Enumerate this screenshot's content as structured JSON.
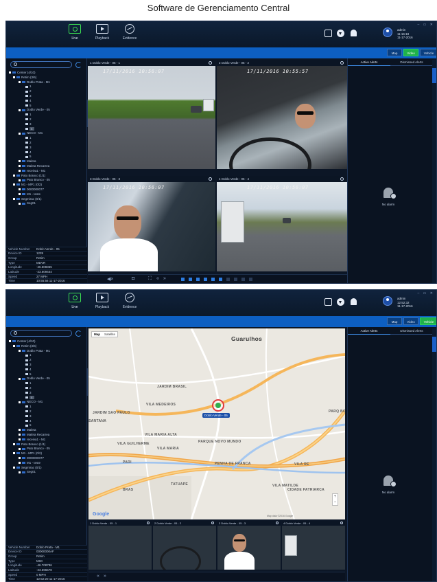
{
  "caption": "Software de Gerenciamento Central",
  "header": {
    "nav": [
      {
        "label": "Live",
        "icon": "monitor-icon",
        "active": true
      },
      {
        "label": "Playback",
        "icon": "playback-icon",
        "active": false
      },
      {
        "label": "Evidence",
        "icon": "evidence-icon",
        "active": false
      }
    ],
    "user": {
      "name": "admin"
    }
  },
  "view_toggle": [
    "Map",
    "Video",
    "Vehicle"
  ],
  "alerts": {
    "tabs": [
      "Active Alerts",
      "Dismissed Alerts"
    ],
    "empty_text": "No alarm"
  },
  "info_labels": [
    "Vehicle Number",
    "Device ID",
    "Group",
    "Type",
    "Longitude",
    "Latitude",
    "Speed",
    "Time"
  ],
  "shot1": {
    "user_time": "11:16:18",
    "user_date": "11-17-2016",
    "tree": [
      {
        "label": "Center (4/10)",
        "level": 0,
        "kind": "folder"
      },
      {
        "label": "Retim (3/6)",
        "level": 1,
        "kind": "folder"
      },
      {
        "label": "Doblo Prata - M1",
        "level": 2,
        "kind": "car"
      },
      {
        "label": "1",
        "level": 3,
        "kind": "cam"
      },
      {
        "label": "2",
        "level": 3,
        "kind": "cam"
      },
      {
        "label": "3",
        "level": 3,
        "kind": "cam"
      },
      {
        "label": "4",
        "level": 3,
        "kind": "cam"
      },
      {
        "label": "5",
        "level": 3,
        "kind": "cam"
      },
      {
        "label": "Doblo Verde - 05",
        "level": 2,
        "kind": "car"
      },
      {
        "label": "1",
        "level": 3,
        "kind": "cam"
      },
      {
        "label": "2",
        "level": 3,
        "kind": "cam"
      },
      {
        "label": "3",
        "level": 3,
        "kind": "cam"
      },
      {
        "label": "4",
        "level": 3,
        "kind": "cam",
        "highlight": true
      },
      {
        "label": "NECO - M1",
        "level": 2,
        "kind": "car"
      },
      {
        "label": "1",
        "level": 3,
        "kind": "cam"
      },
      {
        "label": "2",
        "level": 3,
        "kind": "cam"
      },
      {
        "label": "3",
        "level": 3,
        "kind": "cam"
      },
      {
        "label": "4",
        "level": 3,
        "kind": "cam"
      },
      {
        "label": "5",
        "level": 3,
        "kind": "cam"
      },
      {
        "label": "Maleta",
        "level": 2,
        "kind": "car"
      },
      {
        "label": "Maleta Recarrea",
        "level": 2,
        "kind": "car"
      },
      {
        "label": "receiva1 - M1",
        "level": 2,
        "kind": "car"
      },
      {
        "label": "Pato Branco (1/1)",
        "level": 1,
        "kind": "folder"
      },
      {
        "label": "Pato Branco - 05",
        "level": 2,
        "kind": "car"
      },
      {
        "label": "M1 - MP1 (0/2)",
        "level": 1,
        "kind": "folder"
      },
      {
        "label": "0000000077",
        "level": 2,
        "kind": "car"
      },
      {
        "label": "M1 - teste",
        "level": 2,
        "kind": "car"
      },
      {
        "label": "Segmirac (0/1)",
        "level": 1,
        "kind": "folder"
      },
      {
        "label": "Seg01",
        "level": 2,
        "kind": "car"
      }
    ],
    "info_values": [
      "Doblo Verde - 05",
      "1239",
      "Retim",
      "MDVR",
      "-46.508365",
      "-23.609444",
      "27 MPH",
      "10:55:56 11-17-2016"
    ],
    "cams": [
      {
        "title": "1 Doblo Verde - 05 - 1",
        "stamp": "17/11/2016 10:56:07"
      },
      {
        "title": "2 Doblo Verde - 05 - 2",
        "stamp": "17/11/2016 10:55:57"
      },
      {
        "title": "3 Doblo Verde - 05 - 3",
        "stamp": "17/11/2016 10:56:07"
      },
      {
        "title": "4 Doblo Verde - 05 - 4",
        "stamp": "17/11/2016 10:56:07"
      }
    ]
  },
  "shot2": {
    "user_time": "12:52:32",
    "user_date": "11-17-2016",
    "tree": [
      {
        "label": "Center (4/10)",
        "level": 0,
        "kind": "folder"
      },
      {
        "label": "Retim (3/6)",
        "level": 1,
        "kind": "folder"
      },
      {
        "label": "Doblo Prata - M1",
        "level": 2,
        "kind": "car"
      },
      {
        "label": "1",
        "level": 3,
        "kind": "cam"
      },
      {
        "label": "2",
        "level": 3,
        "kind": "cam"
      },
      {
        "label": "3",
        "level": 3,
        "kind": "cam"
      },
      {
        "label": "4",
        "level": 3,
        "kind": "cam"
      },
      {
        "label": "5",
        "level": 3,
        "kind": "cam"
      },
      {
        "label": "Doblo Verde - 05",
        "level": 2,
        "kind": "car"
      },
      {
        "label": "1",
        "level": 3,
        "kind": "cam"
      },
      {
        "label": "2",
        "level": 3,
        "kind": "cam"
      },
      {
        "label": "3",
        "level": 3,
        "kind": "cam"
      },
      {
        "label": "4",
        "level": 3,
        "kind": "cam",
        "highlight": true
      },
      {
        "label": "NECO - M1",
        "level": 2,
        "kind": "car"
      },
      {
        "label": "1",
        "level": 3,
        "kind": "cam"
      },
      {
        "label": "2",
        "level": 3,
        "kind": "cam"
      },
      {
        "label": "3",
        "level": 3,
        "kind": "cam"
      },
      {
        "label": "4",
        "level": 3,
        "kind": "cam"
      },
      {
        "label": "5",
        "level": 3,
        "kind": "cam"
      },
      {
        "label": "Maleta",
        "level": 2,
        "kind": "car"
      },
      {
        "label": "Maleta Recarrea",
        "level": 2,
        "kind": "car"
      },
      {
        "label": "receiva1 - M1",
        "level": 2,
        "kind": "car"
      },
      {
        "label": "Pato Branco (1/1)",
        "level": 1,
        "kind": "folder"
      },
      {
        "label": "Pato Branco - 05",
        "level": 2,
        "kind": "car"
      },
      {
        "label": "M1 - MP1 (0/2)",
        "level": 1,
        "kind": "folder"
      },
      {
        "label": "0000000077",
        "level": 2,
        "kind": "car"
      },
      {
        "label": "M1 - teste",
        "level": 2,
        "kind": "car"
      },
      {
        "label": "Segmirac (0/1)",
        "level": 1,
        "kind": "folder"
      },
      {
        "label": "Seg01",
        "level": 2,
        "kind": "car"
      }
    ],
    "info_values": [
      "Doblo Prata - M1",
      "00000000AF",
      "Retim",
      "MIM",
      "-46.708786",
      "-23.696578",
      "0 MPH",
      "12:52:20 11-17-2016"
    ],
    "map": {
      "tabs": [
        "Map",
        "Satellite"
      ],
      "labels": [
        {
          "text": "Guarulhos",
          "cls": "big"
        },
        {
          "text": "JARDIM BRASIL",
          "cls": ""
        },
        {
          "text": "VILA MEDEIROS",
          "cls": ""
        },
        {
          "text": "JARDIM SAO PAULO",
          "cls": ""
        },
        {
          "text": "SANTANA",
          "cls": ""
        },
        {
          "text": "VILA MARIA ALTA",
          "cls": ""
        },
        {
          "text": "VILA GUILHERME",
          "cls": ""
        },
        {
          "text": "VILA MARIA",
          "cls": ""
        },
        {
          "text": "PARQUE NOVO MUNDO",
          "cls": ""
        },
        {
          "text": "PARI",
          "cls": ""
        },
        {
          "text": "PENHA DE FRANCA",
          "cls": ""
        },
        {
          "text": "TATUAPE",
          "cls": ""
        },
        {
          "text": "VILA MATILDE",
          "cls": ""
        },
        {
          "text": "CIDADE PATRIARCA",
          "cls": ""
        },
        {
          "text": "VILA RE",
          "cls": ""
        },
        {
          "text": "PARQ BOTUR",
          "cls": ""
        },
        {
          "text": "BRAS",
          "cls": ""
        }
      ],
      "pin_label": "Doblo Verde - 05",
      "logo": "Google",
      "copyright": "Map data ©2016 Google"
    },
    "cams": [
      {
        "title": "1 Doblo Verde - 05 - 1"
      },
      {
        "title": "2 Doblo Verde - 05 - 2"
      },
      {
        "title": "3 Doblo Verde - 05 - 3"
      },
      {
        "title": "4 Doblo Verde - 05 - 4"
      }
    ]
  },
  "colors": {
    "accent": "#0d5fc2",
    "active": "#1fb24a",
    "background": "#0c1626",
    "alarm": "#e23a3a"
  }
}
